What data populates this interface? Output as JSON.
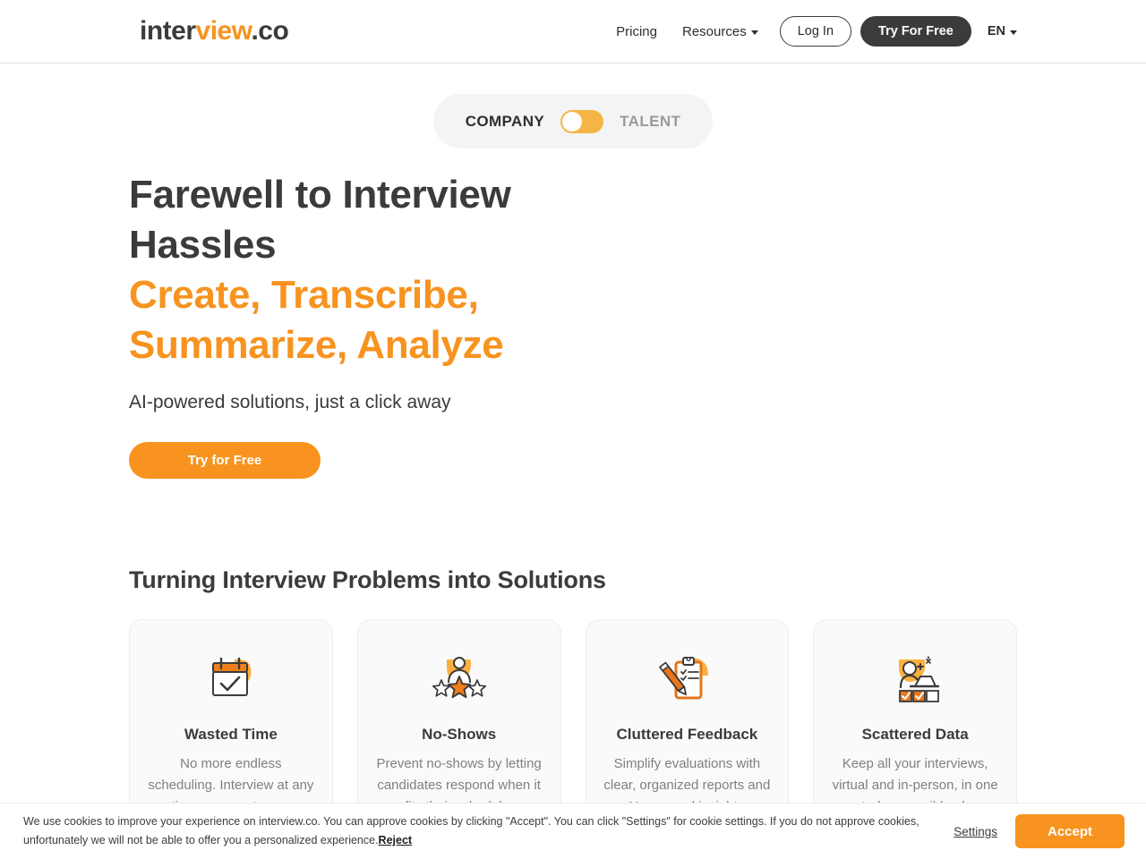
{
  "brand": {
    "logo_part1": "inter",
    "logo_part2": "view",
    "logo_part3": ".co",
    "orange": "#f7931e",
    "dark": "#3b3b3b"
  },
  "header": {
    "nav": [
      {
        "label": "Pricing",
        "icon": null
      },
      {
        "label": "Resources",
        "icon": "chevron-down-icon"
      }
    ],
    "login_label": "Log In",
    "try_label": "Try For Free",
    "language": "EN",
    "language_icon": "chevron-down-icon"
  },
  "audience_toggle": {
    "left_label": "COMPANY",
    "right_label": "TALENT",
    "active": "COMPANY",
    "knob_position": "left",
    "track_color": "#f5b544"
  },
  "hero": {
    "headline_dark": "Farewell to Interview Hassles",
    "headline_accent": "Create, Transcribe, Summarize, Analyze",
    "subheadline": "AI-powered solutions, just a click away",
    "cta_label": "Try for Free"
  },
  "problems_section": {
    "title": "Turning Interview Problems into Solutions",
    "cards": [
      {
        "icon": "calendar-check-icon",
        "title": "Wasted Time",
        "body": "No more endless scheduling. Interview at any time, on your terms."
      },
      {
        "icon": "candidate-rating-stars-icon",
        "title": "No-Shows",
        "body": "Prevent no-shows by letting candidates respond when it fits their schedule."
      },
      {
        "icon": "clipboard-pencil-icon",
        "title": "Cluttered Feedback",
        "body": "Simplify evaluations with clear, organized reports and AI-powered insights."
      },
      {
        "icon": "person-laptop-checklist-icon",
        "title": "Scattered Data",
        "body": "Keep all your interviews, virtual and in-person, in one central, accessible place."
      }
    ]
  },
  "cookie_banner": {
    "text_before_reject": "We use cookies to improve your experience on interview.co. You can approve cookies by clicking \"Accept\". You can click \"Settings\" for cookie settings. If you do not approve cookies, unfortunately we will not be able to offer you a personalized experience.",
    "reject_label": "Reject",
    "settings_label": "Settings",
    "accept_label": "Accept"
  }
}
